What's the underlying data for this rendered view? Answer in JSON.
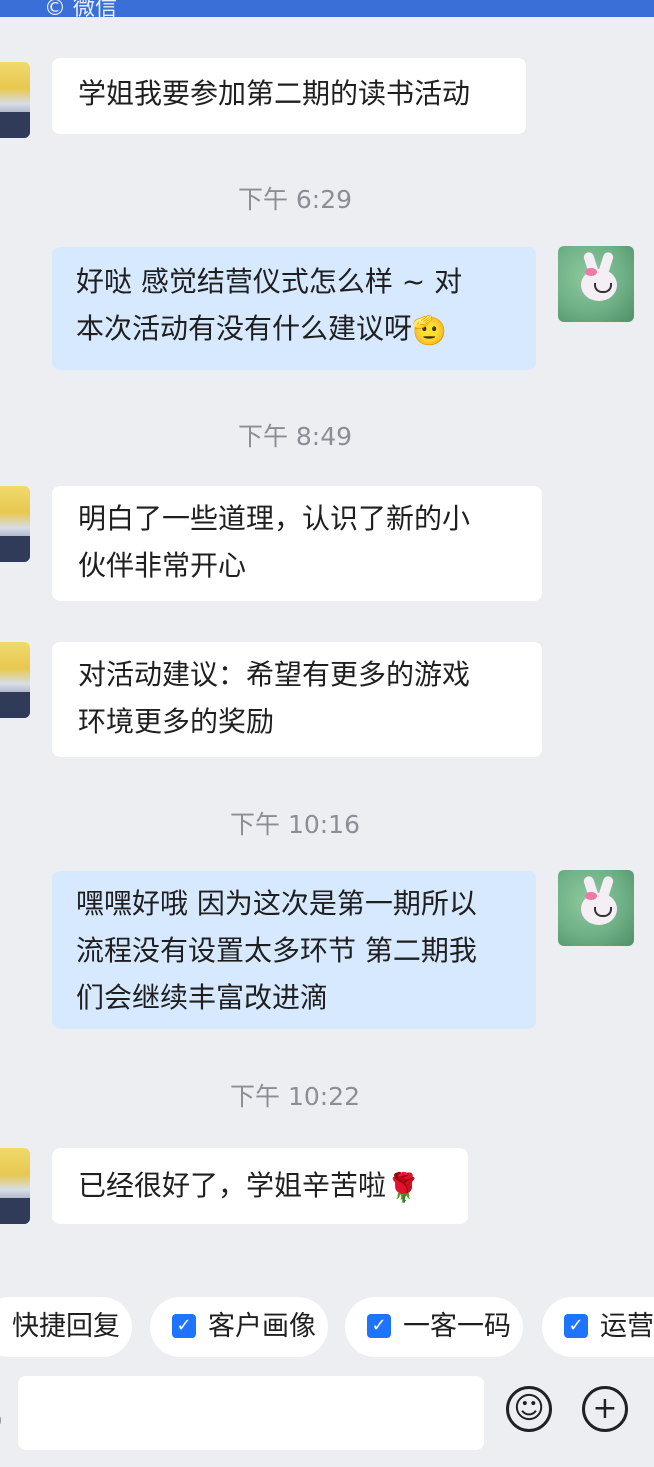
{
  "status": {
    "top_partial_text": "© 微信"
  },
  "messages": [
    {
      "side": "in",
      "lines": [
        "学姐我要参加第二期的读书活动"
      ]
    },
    {
      "timestamp": "下午 6:29"
    },
    {
      "side": "out",
      "lines": [
        "好哒  感觉结营仪式怎么样 ~ 对",
        "本次活动有没有什么建议呀"
      ],
      "emoji": "🫡"
    },
    {
      "timestamp": "下午 8:49"
    },
    {
      "side": "in",
      "lines": [
        "明白了一些道理，认识了新的小",
        "伙伴非常开心"
      ]
    },
    {
      "side": "in",
      "lines": [
        "对活动建议：希望有更多的游戏",
        "环境更多的奖励"
      ]
    },
    {
      "timestamp": "下午 10:16"
    },
    {
      "side": "out",
      "lines": [
        "嘿嘿好哦 因为这次是第一期所以",
        "流程没有设置太多环节 第二期我",
        "们会继续丰富改进滴"
      ]
    },
    {
      "timestamp": "下午 10:22"
    },
    {
      "side": "in",
      "lines": [
        "已经很好了，学姐辛苦啦"
      ],
      "emoji": "🌹"
    }
  ],
  "quick_actions": [
    {
      "label": "快捷回复",
      "checked": false
    },
    {
      "label": "客户画像",
      "checked": true
    },
    {
      "label": "一客一码",
      "checked": true
    },
    {
      "label": "运营",
      "checked": true
    }
  ],
  "composer": {
    "input_value": "",
    "left_partial": ")",
    "emoji_button": "☺",
    "plus_button": "+"
  },
  "colors": {
    "accent": "#3a6fd8",
    "bubble_out": "#d7e9ff",
    "bubble_in": "#ffffff",
    "check": "#1f74ff"
  },
  "icons": {
    "check": "check-icon",
    "emoji": "smile-icon",
    "plus": "plus-icon"
  }
}
